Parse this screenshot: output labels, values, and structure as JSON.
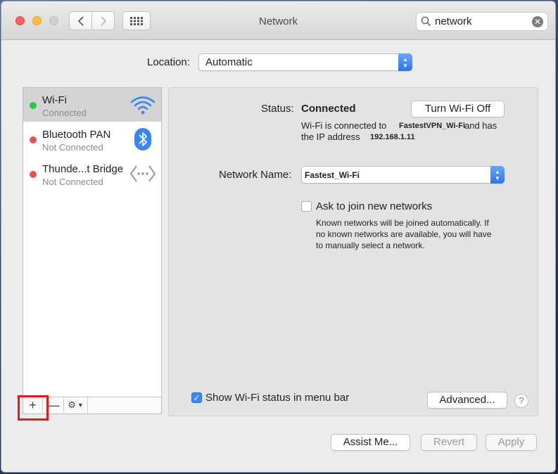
{
  "window": {
    "title": "Network"
  },
  "toolbar": {
    "back_label": "‹",
    "forward_label": "›"
  },
  "search": {
    "value": "network",
    "placeholder": "Search"
  },
  "location": {
    "label": "Location:",
    "value": "Automatic"
  },
  "services": [
    {
      "name": "Wi-Fi",
      "state": "Connected",
      "status_color": "#32c248",
      "icon": "wifi-icon"
    },
    {
      "name": "Bluetooth PAN",
      "state": "Not Connected",
      "status_color": "#e8524a",
      "icon": "bluetooth-icon"
    },
    {
      "name": "Thunde...t Bridge",
      "state": "Not Connected",
      "status_color": "#e8524a",
      "icon": "thunderbolt-bridge-icon"
    }
  ],
  "sidebar_toolbar": {
    "add": "+",
    "remove": "—"
  },
  "detail": {
    "status_label": "Status:",
    "status_value": "Connected",
    "turn_off_button": "Turn Wi-Fi Off",
    "desc_part1": "Wi-Fi is connected to",
    "ssid": "FastestVPN_Wi-Fi",
    "desc_part2": "and has",
    "desc_part3": "the IP address",
    "ip": "192.168.1.11",
    "network_name_label": "Network Name:",
    "network_name_value": "Fastest_Wi-Fi",
    "ask_join_label": "Ask to join new networks",
    "ask_join_checked": false,
    "ask_join_help_1": "Known networks will be joined automatically. If",
    "ask_join_help_2": "no known networks are available, you will have",
    "ask_join_help_3": "to manually select a network.",
    "show_status_label": "Show Wi-Fi status in menu bar",
    "show_status_checked": true,
    "advanced_button": "Advanced...",
    "help_button": "?"
  },
  "footer": {
    "assist": "Assist Me...",
    "revert": "Revert",
    "apply": "Apply"
  },
  "colors": {
    "accent": "#3b86f6",
    "highlight": "#e51b1b"
  }
}
